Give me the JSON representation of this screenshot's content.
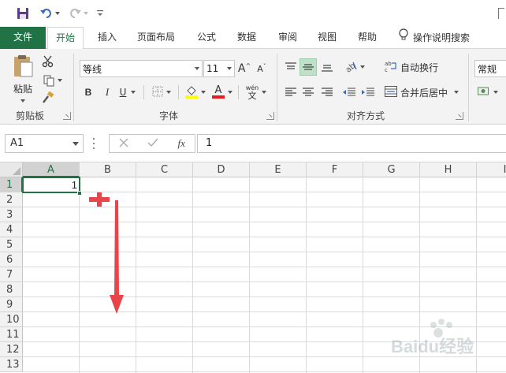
{
  "quick_access": {
    "save": "save-icon",
    "undo": "undo-icon",
    "redo": "redo-icon",
    "customize": "customize-qat-icon"
  },
  "tabs": [
    {
      "label": "文件"
    },
    {
      "label": "开始"
    },
    {
      "label": "插入"
    },
    {
      "label": "页面布局"
    },
    {
      "label": "公式"
    },
    {
      "label": "数据"
    },
    {
      "label": "审阅"
    },
    {
      "label": "视图"
    },
    {
      "label": "帮助"
    }
  ],
  "tell_me": "操作说明搜索",
  "clipboard": {
    "paste": "粘贴",
    "group": "剪贴板"
  },
  "font": {
    "name": "等线",
    "size": "11",
    "bold": "B",
    "italic": "I",
    "underline": "U",
    "group": "字体",
    "grow": "A",
    "shrink": "A",
    "color": "A",
    "phonetic_top": "wén",
    "phonetic_bottom": "文"
  },
  "alignment": {
    "wrap": "自动换行",
    "merge": "合并后居中",
    "group": "对齐方式"
  },
  "number": {
    "format": "常规"
  },
  "formula_bar": {
    "name_box": "A1",
    "fx": "fx",
    "content": "1"
  },
  "grid": {
    "columns": [
      "A",
      "B",
      "C",
      "D",
      "E",
      "F",
      "G",
      "H",
      "I"
    ],
    "rows": [
      "1",
      "2",
      "3",
      "4",
      "5",
      "6",
      "7",
      "8",
      "9",
      "10",
      "11",
      "12",
      "13"
    ],
    "active_cell_value": "1"
  },
  "watermark": "Baidu经验",
  "colors": {
    "excel_green": "#217346",
    "arrow_red": "#e8454a"
  }
}
